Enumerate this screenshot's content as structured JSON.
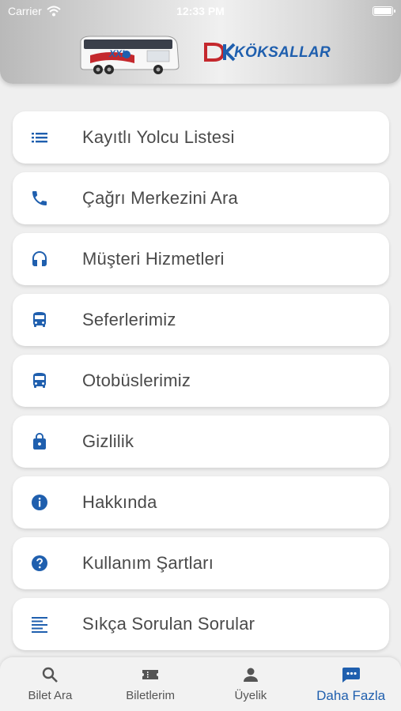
{
  "status_bar": {
    "carrier": "Carrier",
    "time": "12:33 PM"
  },
  "header": {
    "brand": "KÖKSALLAR",
    "bus_badge": "XXL"
  },
  "menu": [
    {
      "label": "Kayıtlı Yolcu Listesi",
      "icon": "list-icon"
    },
    {
      "label": "Çağrı Merkezini Ara",
      "icon": "phone-icon"
    },
    {
      "label": "Müşteri Hizmetleri",
      "icon": "headset-icon"
    },
    {
      "label": "Seferlerimiz",
      "icon": "bus-icon"
    },
    {
      "label": "Otobüslerimiz",
      "icon": "bus-icon"
    },
    {
      "label": "Gizlilik",
      "icon": "lock-icon"
    },
    {
      "label": "Hakkında",
      "icon": "info-icon"
    },
    {
      "label": "Kullanım Şartları",
      "icon": "help-icon"
    },
    {
      "label": "Sıkça Sorulan Sorular",
      "icon": "text-lines-icon"
    }
  ],
  "tabbar": [
    {
      "label": "Bilet Ara",
      "icon": "search-icon",
      "active": false
    },
    {
      "label": "Biletlerim",
      "icon": "ticket-icon",
      "active": false
    },
    {
      "label": "Üyelik",
      "icon": "person-icon",
      "active": false
    },
    {
      "label": "Daha Fazla",
      "icon": "more-chat-icon",
      "active": true
    }
  ],
  "colors": {
    "accent": "#1f5fae",
    "label": "#4a4a4a",
    "background": "#efefef"
  }
}
